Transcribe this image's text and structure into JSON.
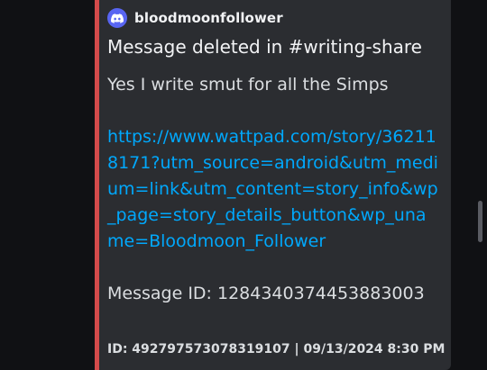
{
  "embed": {
    "accent_color": "#d44b4b",
    "author": {
      "icon": "discord-icon",
      "name": "bloodmoonfollower"
    },
    "title": "Message deleted in #writing-share",
    "description": {
      "text": "Yes I write smut for all the Simps",
      "link": "https://www.wattpad.com/story/362118171?utm_source=android&utm_medium=link&utm_content=story_info&wp_page=story_details_button&wp_uname=Bloodmoon_Follower",
      "message_id": "Message ID: 1284340374453883003"
    },
    "footer": "ID: 492797573078319107 | 09/13/2024 8:30 PM"
  },
  "colors": {
    "background": "#101114",
    "embed_background": "#2b2d31",
    "link": "#00a8fc",
    "discord_blurple": "#5865f2"
  }
}
